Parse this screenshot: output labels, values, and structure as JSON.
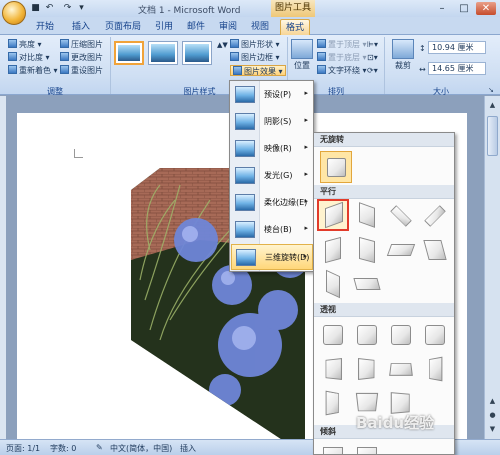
{
  "window": {
    "title": "文档 1 - Microsoft Word",
    "context_tool": "图片工具"
  },
  "tabs": [
    "开始",
    "插入",
    "页面布局",
    "引用",
    "邮件",
    "审阅",
    "视图",
    "格式"
  ],
  "ribbon": {
    "adjust": {
      "label": "调整",
      "items": [
        "亮度",
        "对比度",
        "重新着色",
        "压缩图片",
        "更改图片",
        "重设图片"
      ]
    },
    "picture_styles": {
      "label": "图片样式",
      "items": [
        "图片形状",
        "图片边框",
        "图片效果"
      ]
    },
    "arrange": {
      "label": "排列",
      "position": "位置",
      "items": [
        "置于顶层",
        "置于底层",
        "文字环绕"
      ]
    },
    "size": {
      "label": "大小",
      "crop": "裁剪",
      "height": "10.94 厘米",
      "width": "14.65 厘米"
    }
  },
  "effects_menu": {
    "items": [
      {
        "label": "预设(P)"
      },
      {
        "label": "阴影(S)"
      },
      {
        "label": "映像(R)"
      },
      {
        "label": "发光(G)"
      },
      {
        "label": "柔化边缘(E)"
      },
      {
        "label": "棱台(B)"
      },
      {
        "label": "三维旋转(D)"
      }
    ],
    "highlighted_index": 6
  },
  "rotation_gallery": {
    "sections": [
      "无旋转",
      "平行",
      "透视",
      "倾斜"
    ],
    "selected": "平行-1"
  },
  "status": {
    "page": "页面: 1/1",
    "words": "字数: 0",
    "language": "中文(简体，中国)",
    "mode": "插入"
  },
  "watermark": "Baidu经验",
  "colors": {
    "ribbon": "#dfeaf8",
    "context_tab": "#f0c978",
    "selection": "#e23b2a"
  }
}
